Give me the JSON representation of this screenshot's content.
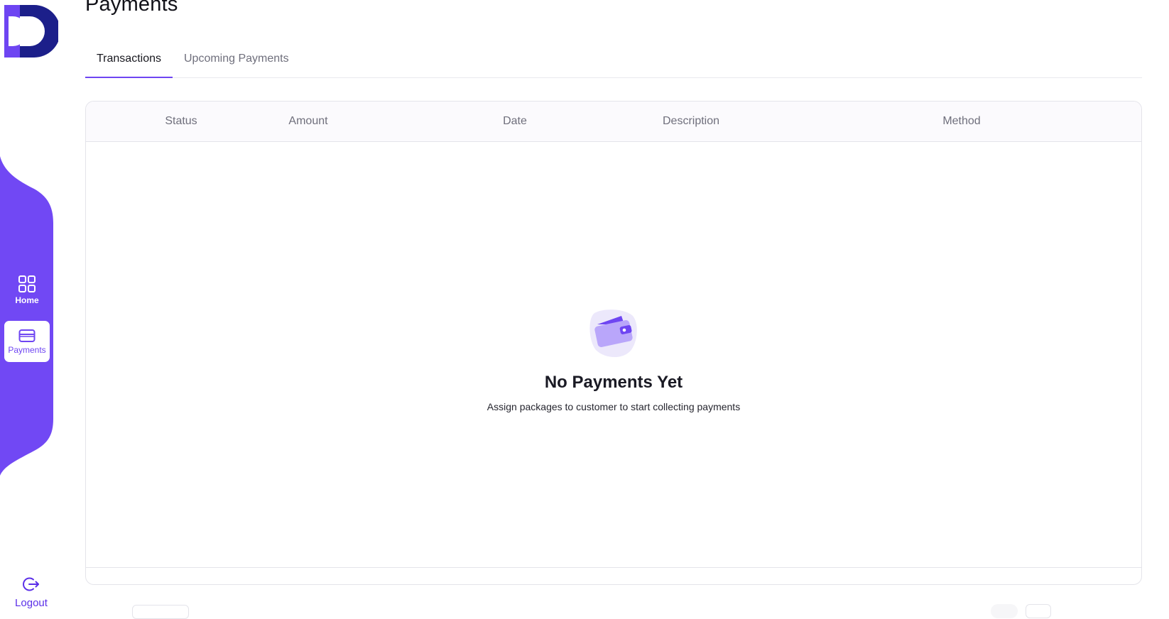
{
  "page": {
    "title": "Payments"
  },
  "brand": {
    "logo_icon": "dd-logo-icon",
    "primary_color": "#6e45f2",
    "dark_color": "#1c1f8a"
  },
  "sidebar": {
    "items": [
      {
        "label": "Home",
        "icon": "grid-icon",
        "active": false
      },
      {
        "label": "Payments",
        "icon": "card-icon",
        "active": true
      }
    ],
    "logout": {
      "label": "Logout",
      "icon": "logout-icon"
    }
  },
  "tabs": [
    {
      "label": "Transactions",
      "active": true
    },
    {
      "label": "Upcoming Payments",
      "active": false
    }
  ],
  "table": {
    "columns": [
      "Status",
      "Amount",
      "Date",
      "Description",
      "Method"
    ],
    "rows": []
  },
  "empty_state": {
    "icon": "wallet-icon",
    "title": "No Payments Yet",
    "subtitle": "Assign packages to customer to start collecting payments"
  }
}
